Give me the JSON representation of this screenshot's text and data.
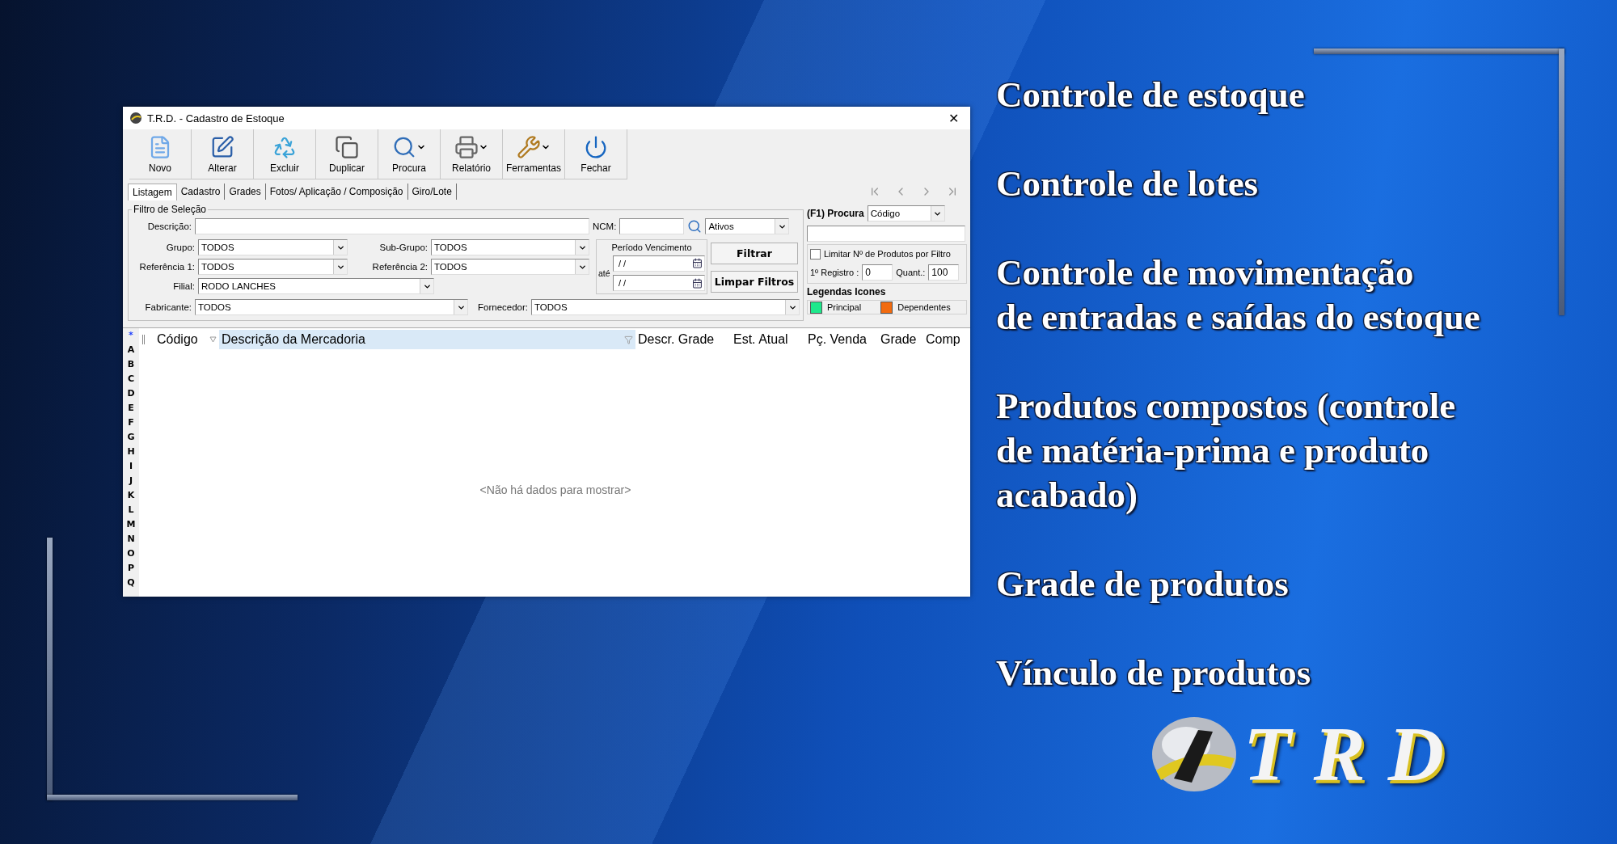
{
  "window": {
    "title": "T.R.D. - Cadastro de Estoque",
    "close": "✕"
  },
  "toolbar": [
    {
      "label": "Novo",
      "has_menu": false
    },
    {
      "label": "Alterar",
      "has_menu": false
    },
    {
      "label": "Excluir",
      "has_menu": false
    },
    {
      "label": "Duplicar",
      "has_menu": false
    },
    {
      "label": "Procura",
      "has_menu": true
    },
    {
      "label": "Relatório",
      "has_menu": true
    },
    {
      "label": "Ferramentas",
      "has_menu": true
    },
    {
      "label": "Fechar",
      "has_menu": false
    }
  ],
  "tabs": [
    {
      "label": "Listagem",
      "selected": true
    },
    {
      "label": "Cadastro",
      "selected": false
    },
    {
      "label": "Grades",
      "selected": false
    },
    {
      "label": "Fotos/ Aplicação / Composição",
      "selected": false
    },
    {
      "label": "Giro/Lote",
      "selected": false
    }
  ],
  "filter": {
    "title": "Filtro de Seleção",
    "descricao": {
      "label": "Descrição:"
    },
    "ncm": {
      "label": "NCM:"
    },
    "status": {
      "value": "Ativos"
    },
    "grupo": {
      "label": "Grupo:",
      "value": "TODOS"
    },
    "sub_grupo": {
      "label": "Sub-Grupo:",
      "value": "TODOS"
    },
    "referencia_1": {
      "label": "Referência 1:",
      "value": "TODOS"
    },
    "referencia_2": {
      "label": "Referência 2:",
      "value": "TODOS"
    },
    "filial": {
      "label": "Filial:",
      "value": "RODO LANCHES"
    },
    "fabricante": {
      "label": "Fabricante:",
      "value": "TODOS"
    },
    "fornecedor": {
      "label": "Fornecedor:",
      "value": "TODOS"
    },
    "periodo": {
      "title": "Período Vencimento",
      "ate": "até",
      "from": "/ /",
      "to": "/ /"
    },
    "buttons": [
      "Filtrar",
      "Limpar Filtros"
    ]
  },
  "search_panel": {
    "label": "(F1) Procura",
    "field": "Código",
    "limit_label": "Limitar Nº de Produtos por Filtro",
    "limit_checked": false,
    "registro_label": "1º Registro :",
    "registro": "0",
    "quant_label": "Quant.:",
    "quant": "100",
    "legend_title": "Legendas Icones",
    "legend": [
      {
        "label": "Principal",
        "color": "#1ee88c"
      },
      {
        "label": "Dependentes",
        "color": "#f26b0f"
      }
    ]
  },
  "grid": {
    "index": [
      "*",
      "A",
      "B",
      "C",
      "D",
      "E",
      "F",
      "G",
      "H",
      "I",
      "J",
      "K",
      "L",
      "M",
      "N",
      "O",
      "P",
      "Q"
    ],
    "columns": [
      {
        "label": "Código",
        "selected": false,
        "sorted": true
      },
      {
        "label": "Descrição da Mercadoria",
        "selected": true,
        "sorted": false
      },
      {
        "label": "Descr. Grade",
        "selected": false,
        "sorted": false
      },
      {
        "label": "Est. Atual",
        "selected": false,
        "sorted": false
      },
      {
        "label": "Pç. Venda",
        "selected": false,
        "sorted": false
      },
      {
        "label": "Grade",
        "selected": false,
        "sorted": false
      },
      {
        "label": "Comp",
        "selected": false,
        "sorted": false
      }
    ],
    "empty": "<Não há dados para mostrar>"
  },
  "features": [
    {
      "lines": [
        "Controle de estoque"
      ]
    },
    {
      "lines": [
        "Controle de lotes"
      ]
    },
    {
      "lines": [
        "Controle de movimentação",
        "de entradas e saídas do estoque"
      ]
    },
    {
      "lines": [
        "Produtos compostos (controle",
        "de matéria-prima e produto",
        "acabado)"
      ]
    },
    {
      "lines": [
        "Grade de produtos"
      ]
    },
    {
      "lines": [
        "Vínculo de produtos"
      ]
    }
  ],
  "logo": {
    "text": "TRD"
  }
}
